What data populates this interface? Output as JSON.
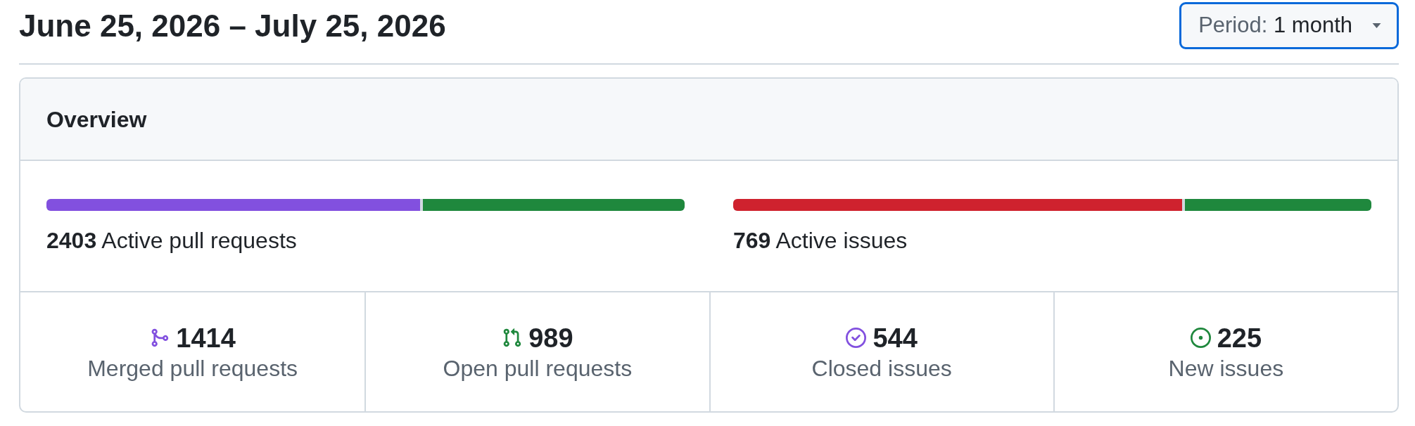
{
  "header": {
    "title": "June 25, 2026 – July 25, 2026",
    "period_button": {
      "label": "Period:",
      "value": "1 month"
    }
  },
  "overview": {
    "title": "Overview",
    "summaries": [
      {
        "count": "2403",
        "label": "Active pull requests",
        "segments": [
          {
            "level": 0.588,
            "color": "#8250df"
          },
          {
            "level": 0.412,
            "color": "#1f883d"
          }
        ]
      },
      {
        "count": "769",
        "label": "Active issues",
        "segments": [
          {
            "level": 0.707,
            "color": "#cf222e"
          },
          {
            "level": 0.293,
            "color": "#1f883d"
          }
        ]
      }
    ],
    "stats": [
      {
        "kind": "merged_pr",
        "count": "1414",
        "label": "Merged pull requests"
      },
      {
        "kind": "open_pr",
        "count": "989",
        "label": "Open pull requests"
      },
      {
        "kind": "closed_issue",
        "count": "544",
        "label": "Closed issues"
      },
      {
        "kind": "new_issue",
        "count": "225",
        "label": "New issues"
      }
    ]
  }
}
